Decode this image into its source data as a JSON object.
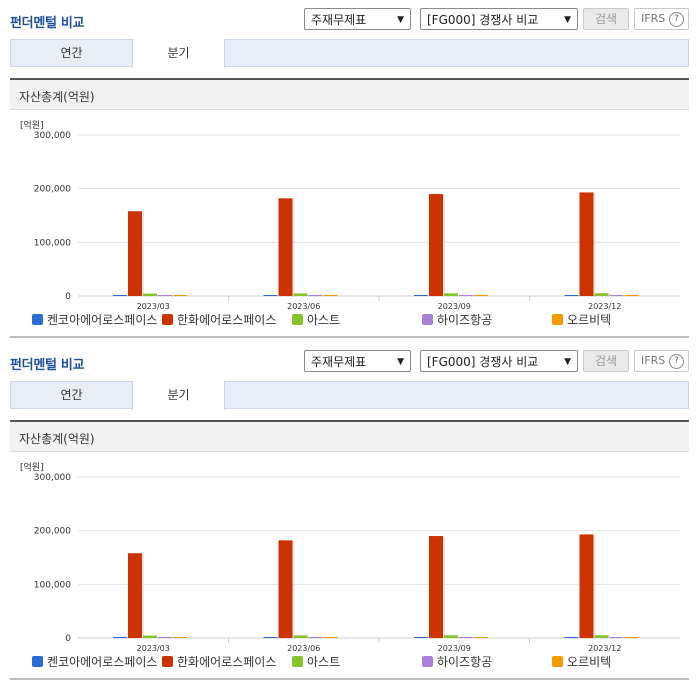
{
  "header": {
    "title": "펀더멘털 비교",
    "statement_select": "주재무제표",
    "peer_select": "[FG000] 경쟁사 비교",
    "search_label": "검색",
    "ifrs_label": "IFRS",
    "help_glyph": "?"
  },
  "tabs": [
    {
      "label": "연간",
      "active": false
    },
    {
      "label": "분기",
      "active": true
    }
  ],
  "section": {
    "title": "자산총계(억원)",
    "unit": "[억원]"
  },
  "colors": {
    "title": "#1f4e9c",
    "grid": "#e3e3e3",
    "axis": "#999999"
  },
  "chart_data": {
    "type": "bar",
    "categories": [
      "2023/03",
      "2023/06",
      "2023/09",
      "2023/12"
    ],
    "ylim": [
      0,
      300000
    ],
    "yticks": [
      0,
      100000,
      200000,
      300000
    ],
    "ytick_labels": [
      "0",
      "100,000",
      "200,000",
      "300,000"
    ],
    "ylabel": "[억원]",
    "grid": true,
    "legend_position": "bottom",
    "series": [
      {
        "name": "켄코아에어로스페이스",
        "color": "#2a6bd6",
        "values": [
          1500,
          1500,
          1500,
          1500
        ]
      },
      {
        "name": "한화에어로스페이스",
        "color": "#cc3300",
        "values": [
          158000,
          182000,
          190000,
          193000
        ]
      },
      {
        "name": "아스트",
        "color": "#88c32a",
        "values": [
          4500,
          4800,
          5000,
          5200
        ]
      },
      {
        "name": "하이즈항공",
        "color": "#a97fdc",
        "values": [
          1200,
          1200,
          1200,
          1200
        ]
      },
      {
        "name": "오르비텍",
        "color": "#f59a00",
        "values": [
          800,
          800,
          800,
          800
        ]
      }
    ]
  }
}
